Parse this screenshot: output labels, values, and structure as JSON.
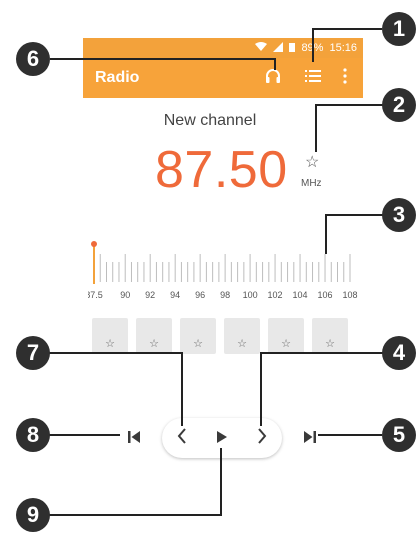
{
  "status": {
    "battery": "89%",
    "time": "15:16"
  },
  "app": {
    "title": "Radio"
  },
  "station": {
    "name": "New channel",
    "frequency": "87.50",
    "unit": "MHz",
    "favorite_symbol": "☆"
  },
  "tuner": {
    "labels": [
      "87.5",
      "90",
      "92",
      "94",
      "96",
      "98",
      "100",
      "102",
      "104",
      "106",
      "108"
    ],
    "current": 87.5
  },
  "presets": [
    {
      "symbol": "☆"
    },
    {
      "symbol": "☆"
    },
    {
      "symbol": "☆"
    },
    {
      "symbol": "☆"
    },
    {
      "symbol": "☆"
    },
    {
      "symbol": "☆"
    }
  ],
  "callouts": [
    "1",
    "2",
    "3",
    "4",
    "5",
    "6",
    "7",
    "8",
    "9"
  ],
  "icons": {
    "headphones": "headphones-icon",
    "list": "list-icon",
    "more": "more-vert-icon",
    "prev": "chevron-left-icon",
    "play": "play-icon",
    "next": "chevron-right-icon",
    "skip_prev": "skip-previous-icon",
    "skip_next": "skip-next-icon"
  },
  "colors": {
    "accent": "#f7a33a",
    "frequency": "#ef6a3a",
    "callout": "#2f2f2f"
  }
}
